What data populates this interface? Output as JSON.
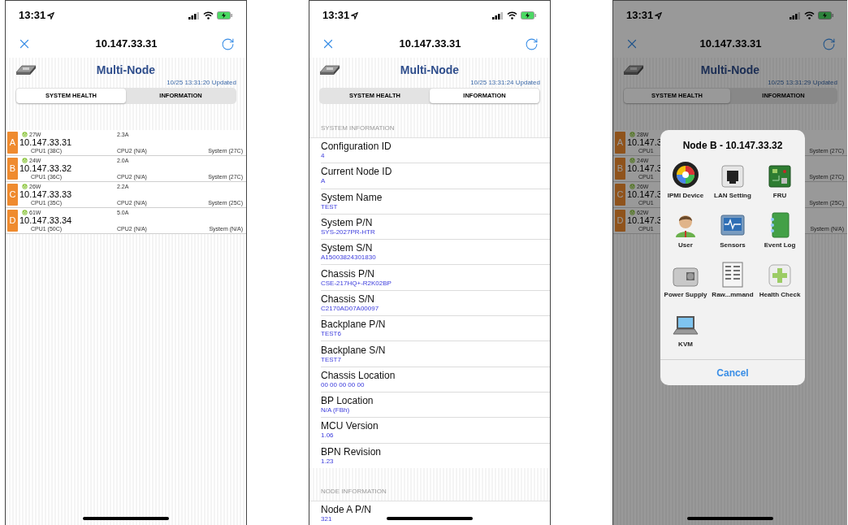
{
  "screens": [
    {
      "kind": "health",
      "time": "13:31",
      "nav_title": "10.147.33.31",
      "header": {
        "title": "Multi-Node",
        "updated": "10/25 13:31:20 Updated"
      },
      "tabs": [
        {
          "label": "SYSTEM HEALTH",
          "selected": true
        },
        {
          "label": "INFORMATION",
          "selected": false
        }
      ],
      "nodes": [
        {
          "letter": "A",
          "power": "27W",
          "current": "2.3A",
          "ip": "10.147.33.31",
          "cpu1": "CPU1 (38C)",
          "cpu2": "CPU2 (N/A)",
          "system": "System (27C)"
        },
        {
          "letter": "B",
          "power": "24W",
          "current": "2.0A",
          "ip": "10.147.33.32",
          "cpu1": "CPU1 (36C)",
          "cpu2": "CPU2 (N/A)",
          "system": "System (27C)"
        },
        {
          "letter": "C",
          "power": "26W",
          "current": "2.2A",
          "ip": "10.147.33.33",
          "cpu1": "CPU1 (35C)",
          "cpu2": "CPU2 (N/A)",
          "system": "System (25C)"
        },
        {
          "letter": "D",
          "power": "61W",
          "current": "5.0A",
          "ip": "10.147.33.34",
          "cpu1": "CPU1 (50C)",
          "cpu2": "CPU2 (N/A)",
          "system": "System (N/A)"
        }
      ]
    },
    {
      "kind": "information",
      "time": "13:31",
      "nav_title": "10.147.33.31",
      "header": {
        "title": "Multi-Node",
        "updated": "10/25 13:31:24 Updated"
      },
      "tabs": [
        {
          "label": "SYSTEM HEALTH",
          "selected": false
        },
        {
          "label": "INFORMATION",
          "selected": true
        }
      ],
      "sections": [
        {
          "title": "SYSTEM INFORMATION",
          "items": [
            {
              "label": "Configuration ID",
              "value": "4"
            },
            {
              "label": "Current Node ID",
              "value": "A"
            },
            {
              "label": "System Name",
              "value": "TEST"
            },
            {
              "label": "System P/N",
              "value": "SYS-2027PR-HTR"
            },
            {
              "label": "System S/N",
              "value": "A15003824301830"
            },
            {
              "label": "Chassis P/N",
              "value": "CSE-217HQ+-R2K02BP"
            },
            {
              "label": "Chassis S/N",
              "value": "C2170AD07A00097"
            },
            {
              "label": "Backplane P/N",
              "value": "TEST6"
            },
            {
              "label": "Backplane S/N",
              "value": "TEST7"
            },
            {
              "label": "Chassis Location",
              "value": "00 00 00 00 00"
            },
            {
              "label": "BP Location",
              "value": "N/A (FBh)"
            },
            {
              "label": "MCU Version",
              "value": "1.06"
            },
            {
              "label": "BPN Revision",
              "value": "1.23"
            }
          ]
        },
        {
          "title": "NODE INFORMATION",
          "items": [
            {
              "label": "Node A P/N",
              "value": "321"
            }
          ]
        }
      ]
    },
    {
      "kind": "health",
      "time": "13:31",
      "nav_title": "10.147.33.31",
      "header": {
        "title": "Multi-Node",
        "updated": "10/25 13:31:29 Updated"
      },
      "tabs": [
        {
          "label": "SYSTEM HEALTH",
          "selected": true
        },
        {
          "label": "INFORMATION",
          "selected": false
        }
      ],
      "nodes": [
        {
          "letter": "A",
          "power": "28W",
          "ip": "10.147.3",
          "cpu1": "CPU1",
          "system": "System (27C)"
        },
        {
          "letter": "B",
          "power": "24W",
          "ip": "10.147.3",
          "cpu1": "CPU1",
          "system": "System (27C)"
        },
        {
          "letter": "C",
          "power": "26W",
          "ip": "10.147.3",
          "cpu1": "CPU1",
          "system": "System (25C)"
        },
        {
          "letter": "D",
          "power": "62W",
          "ip": "10.147.3",
          "cpu1": "CPU1",
          "system": "System (N/A)"
        }
      ],
      "dialog": {
        "title": "Node B - 10.147.33.32",
        "items": [
          {
            "label": "IPMI Device"
          },
          {
            "label": "LAN Setting"
          },
          {
            "label": "FRU"
          },
          {
            "label": "User"
          },
          {
            "label": "Sensors"
          },
          {
            "label": "Event Log"
          },
          {
            "label": "Power Supply"
          },
          {
            "label": "Raw...mmand"
          },
          {
            "label": "Health Check"
          },
          {
            "label": "KVM"
          }
        ],
        "cancel": "Cancel"
      }
    }
  ]
}
